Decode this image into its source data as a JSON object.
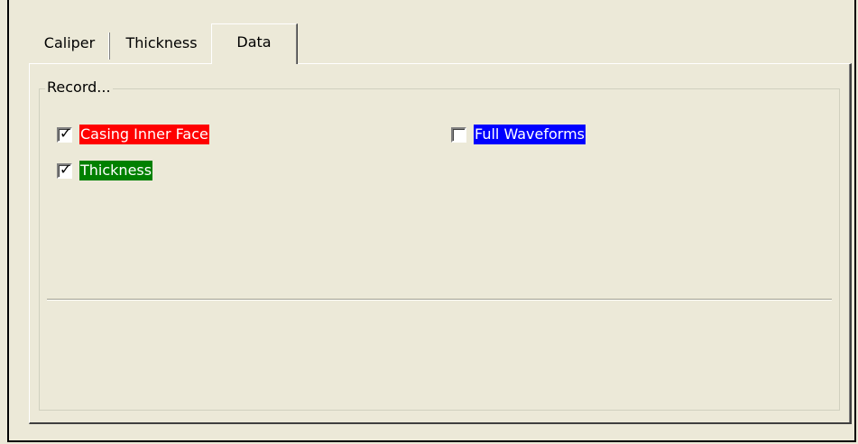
{
  "tabs": [
    {
      "label": "Caliper",
      "active": false
    },
    {
      "label": "Thickness",
      "active": false
    },
    {
      "label": "Data",
      "active": true
    }
  ],
  "record_group": {
    "title": "Record...",
    "options": [
      {
        "label": "Casing Inner Face",
        "checked": true,
        "color": "#ff0000"
      },
      {
        "label": "Thickness",
        "checked": true,
        "color": "#008000"
      },
      {
        "label": "Full Waveforms",
        "checked": false,
        "color": "#0000ff"
      }
    ]
  },
  "colors": {
    "background": "#ece9d8",
    "casing_inner_face": "#ff0000",
    "thickness": "#008000",
    "full_waveforms": "#0000ff"
  }
}
